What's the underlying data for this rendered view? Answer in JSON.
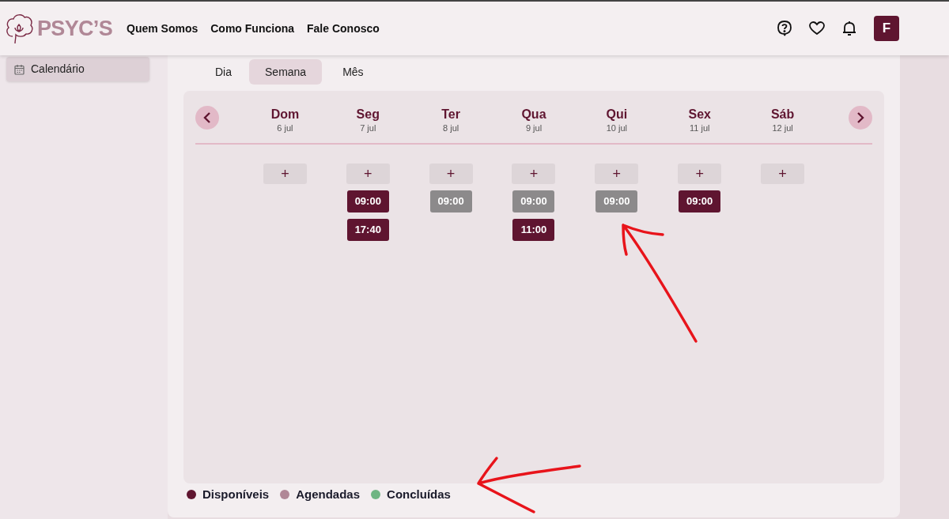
{
  "brand": {
    "name": "PSYC’S"
  },
  "nav": [
    "Quem Somos",
    "Como Funciona",
    "Fale Conosco"
  ],
  "user": {
    "initial": "F"
  },
  "sidebar": {
    "items": [
      {
        "label": "Calendário",
        "selected": true
      }
    ]
  },
  "view_tabs": [
    {
      "label": "Dia",
      "selected": false
    },
    {
      "label": "Semana",
      "selected": true
    },
    {
      "label": "Mês",
      "selected": false
    }
  ],
  "days": [
    {
      "name": "Dom",
      "date": "6 jul"
    },
    {
      "name": "Seg",
      "date": "7 jul",
      "slots": [
        {
          "time": "09:00",
          "color": "#5f1530"
        },
        {
          "time": "17:40",
          "color": "#5f1530"
        }
      ]
    },
    {
      "name": "Ter",
      "date": "8 jul",
      "slots": [
        {
          "time": "09:00",
          "color": "#8c8a8b"
        }
      ]
    },
    {
      "name": "Qua",
      "date": "9 jul",
      "slots": [
        {
          "time": "09:00",
          "color": "#8c8a8b"
        },
        {
          "time": "11:00",
          "color": "#5f1530"
        }
      ]
    },
    {
      "name": "Qui",
      "date": "10 jul",
      "slots": [
        {
          "time": "09:00",
          "color": "#8c8a8b"
        }
      ]
    },
    {
      "name": "Sex",
      "date": "11 jul",
      "slots": [
        {
          "time": "09:00",
          "color": "#5f1530"
        }
      ]
    },
    {
      "name": "Sáb",
      "date": "12 jul"
    }
  ],
  "add_label": "+",
  "legend": [
    {
      "label": "Disponíveis",
      "color": "#5f1530"
    },
    {
      "label": "Agendadas",
      "color": "#b08796"
    },
    {
      "label": "Concluídas",
      "color": "#6fb583"
    }
  ]
}
